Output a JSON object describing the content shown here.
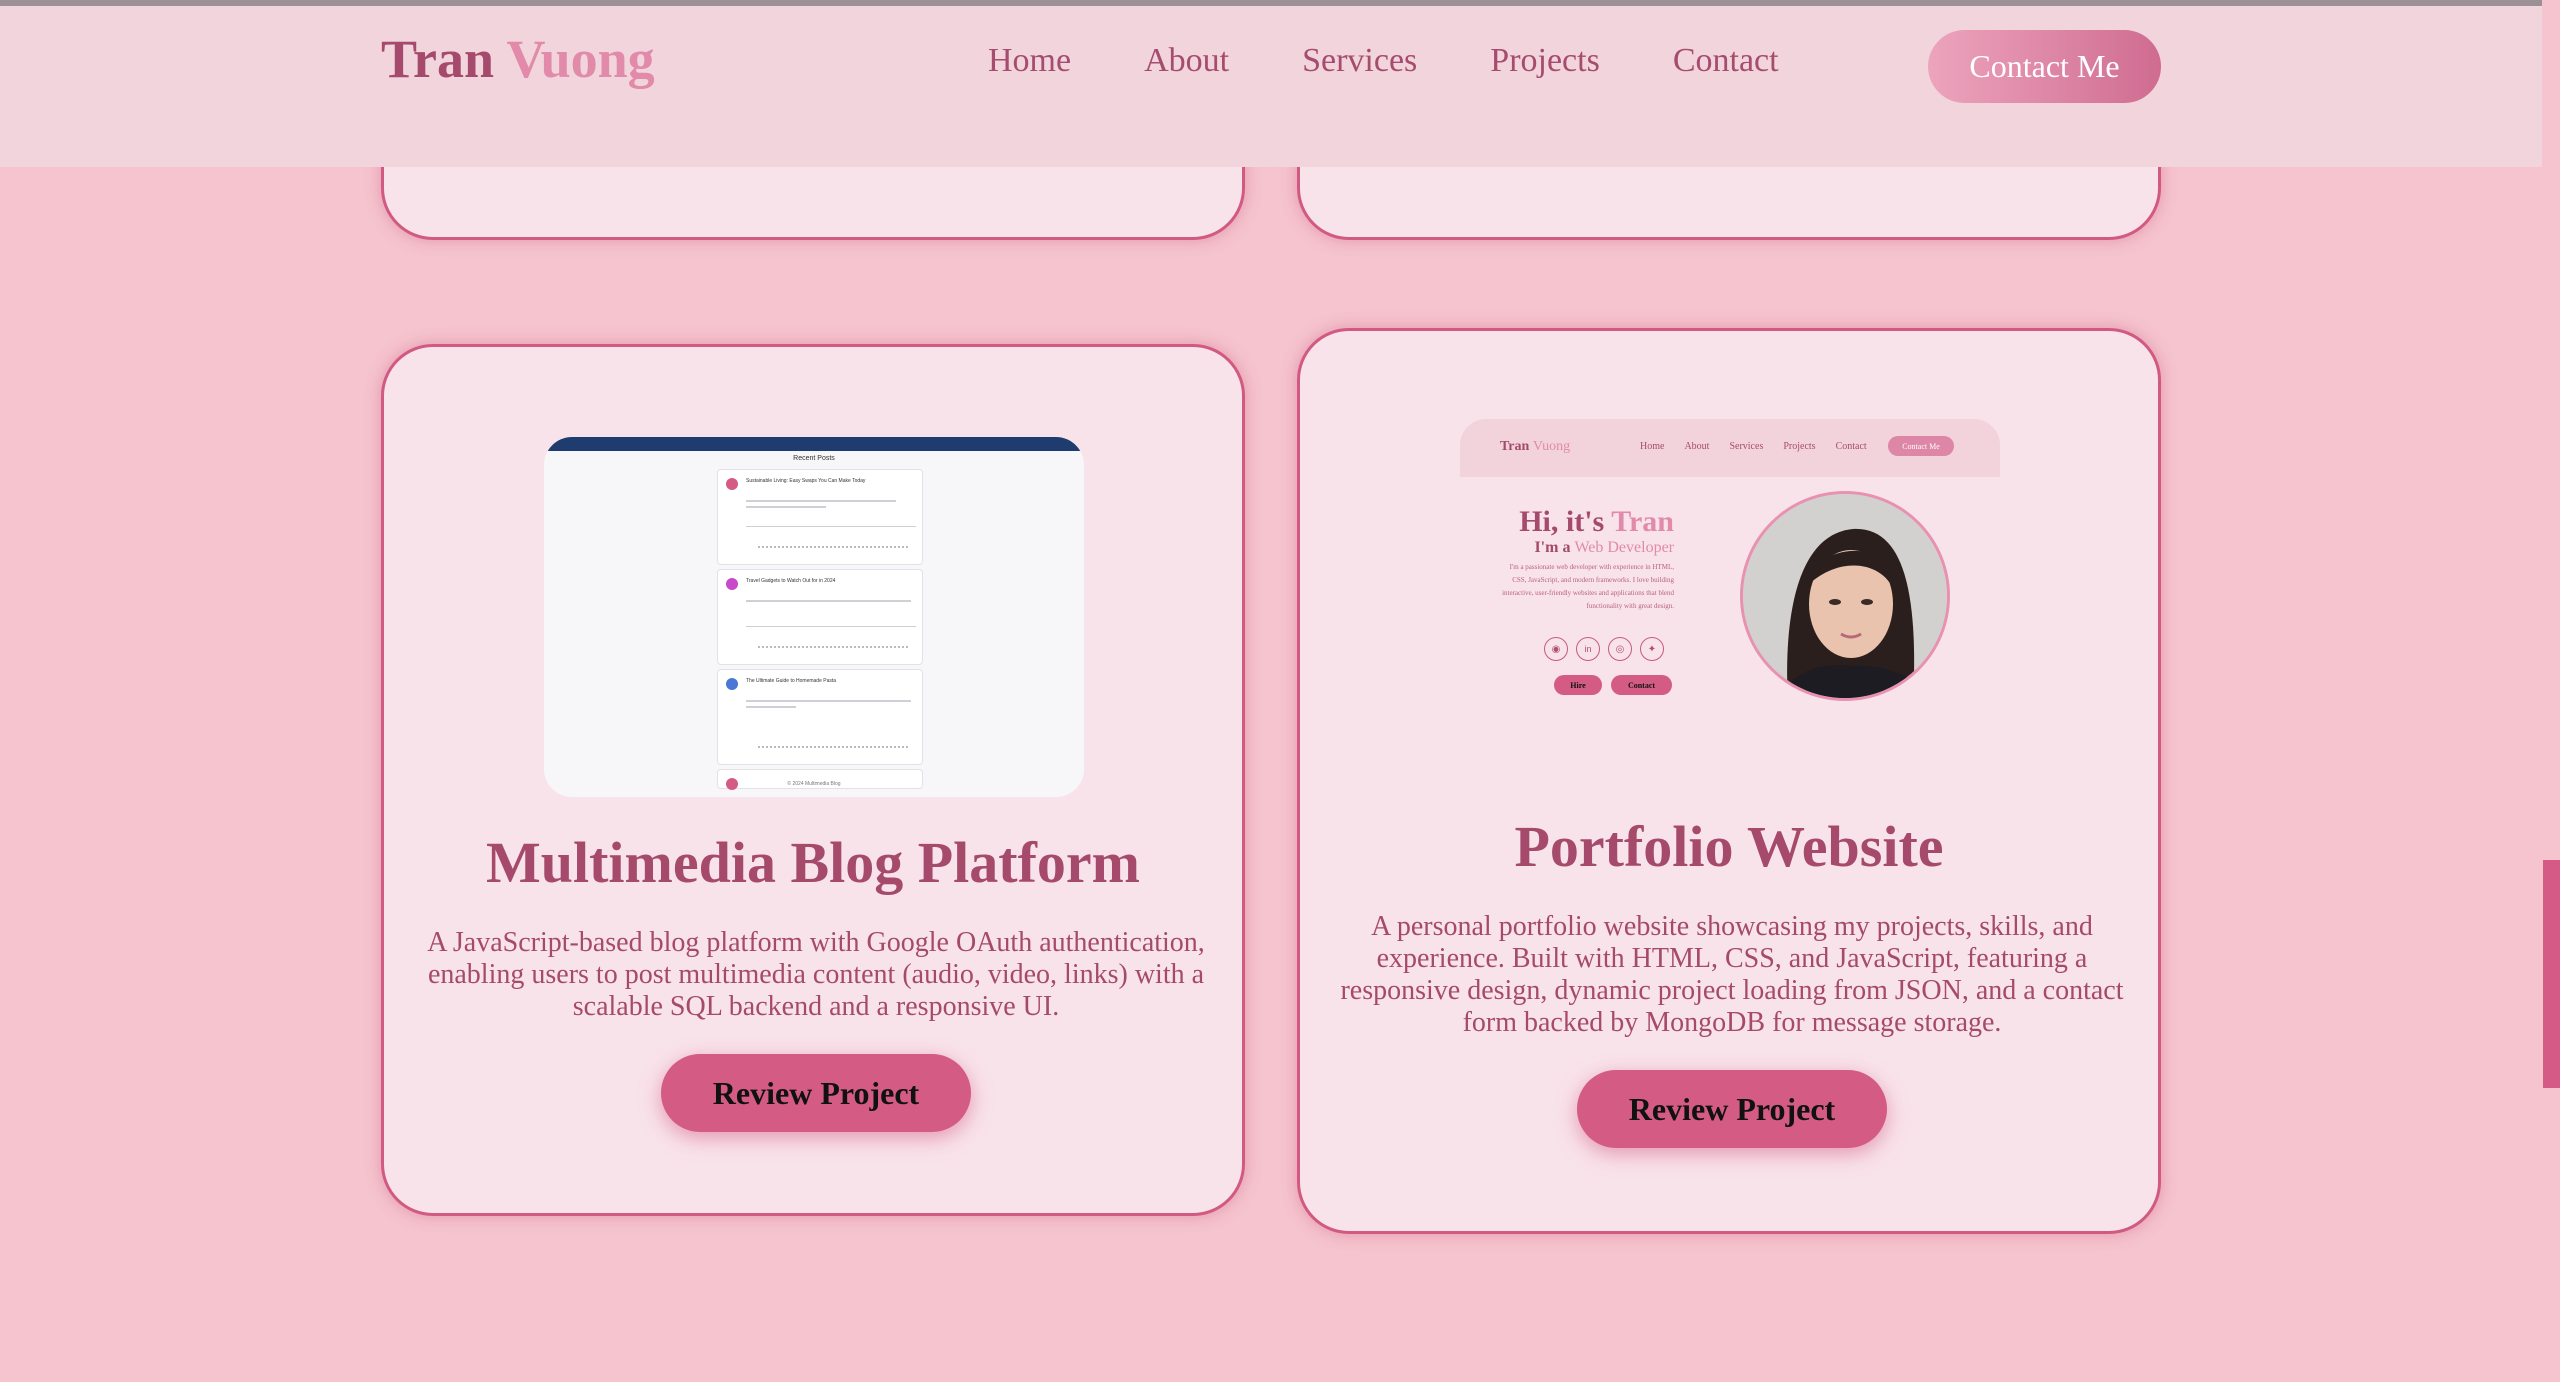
{
  "header": {
    "logo_first": "Tran",
    "logo_second": "Vuong",
    "nav": [
      "Home",
      "About",
      "Services",
      "Projects",
      "Contact"
    ],
    "cta_label": "Contact Me"
  },
  "projects": [
    {
      "title": "Multimedia Blog Platform",
      "description": "A JavaScript-based blog platform with Google OAuth authentication, enabling users to post multimedia content (audio, video, links) with a scalable SQL backend and a responsive UI.",
      "button_label": "Review Project",
      "thumbnail": {
        "heading": "Recent Posts",
        "posts": [
          "Sustainable Living: Easy Swaps You Can Make Today",
          "Travel Gadgets to Watch Out for in 2024",
          "The Ultimate Guide to Homemade Pasta"
        ],
        "footer": "© 2024 Multimedia Blog"
      }
    },
    {
      "title": "Portfolio Website",
      "description": "A personal portfolio website showcasing my projects, skills, and experience. Built with HTML, CSS, and JavaScript, featuring a responsive design, dynamic project loading from JSON, and a contact form backed by MongoDB for message storage.",
      "button_label": "Review Project",
      "thumbnail": {
        "logo_first": "Tran",
        "logo_second": "Vuong",
        "nav": [
          "Home",
          "About",
          "Services",
          "Projects",
          "Contact"
        ],
        "cta_label": "Contact Me",
        "hi_prefix": "Hi, it's",
        "hi_name": "Tran",
        "role_prefix": "I'm a",
        "role_accent": "Web Developer",
        "bio": "I'm a passionate web developer with experience in HTML, CSS, JavaScript, and modern frameworks. I love building interactive, user-friendly websites and applications that blend functionality with great design.",
        "hire_label": "Hire",
        "contact_label": "Contact",
        "socials": [
          "github-icon",
          "linkedin-icon",
          "instagram-icon",
          "twitter-icon"
        ]
      }
    }
  ],
  "colors": {
    "background": "#f5c4ce",
    "header": "#f2d4dc",
    "card": "#f9e3ea",
    "accent": "#d45b84",
    "text": "#a64a6c",
    "logo_accent": "#e18aa9"
  }
}
